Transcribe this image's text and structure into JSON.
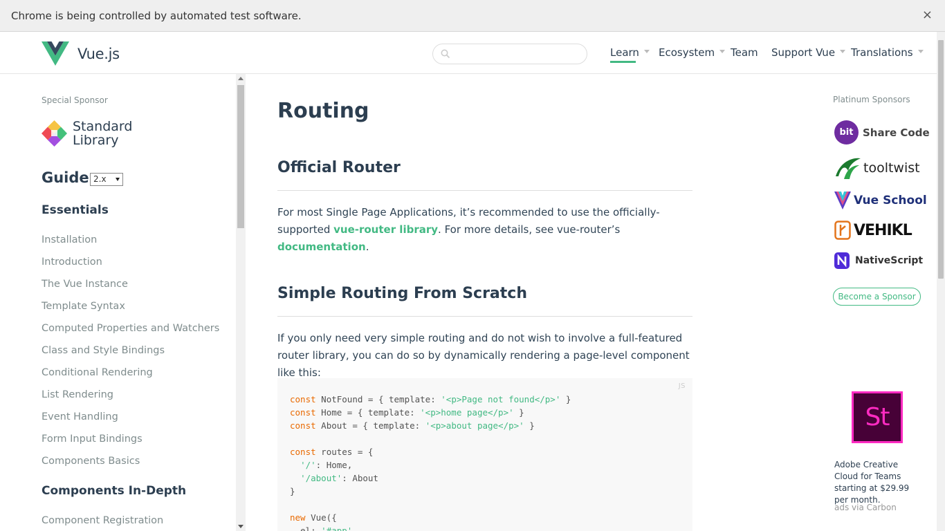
{
  "infobar": {
    "text": "Chrome is being controlled by automated test software.",
    "close": "×"
  },
  "header": {
    "logo_text": "Vue.js",
    "search_placeholder": "",
    "nav": [
      {
        "label": "Learn",
        "dropdown": true,
        "active": true
      },
      {
        "label": "Ecosystem",
        "dropdown": true
      },
      {
        "label": "Team",
        "dropdown": false
      },
      {
        "label": "Support Vue",
        "dropdown": true
      },
      {
        "label": "Translations",
        "dropdown": true
      }
    ]
  },
  "sidebar": {
    "special_sponsor_label": "Special Sponsor",
    "sponsor_line1": "Standard",
    "sponsor_line2": "Library",
    "guide_title": "Guide",
    "version": "2.x",
    "section_essentials": "Essentials",
    "essentials": [
      "Installation",
      "Introduction",
      "The Vue Instance",
      "Template Syntax",
      "Computed Properties and Watchers",
      "Class and Style Bindings",
      "Conditional Rendering",
      "List Rendering",
      "Event Handling",
      "Form Input Bindings",
      "Components Basics"
    ],
    "section_components": "Components In-Depth",
    "components": [
      "Component Registration"
    ]
  },
  "main": {
    "title": "Routing",
    "h2_official": "Official Router",
    "p1_a": "For most Single Page Applications, it’s recommended to use the officially-supported ",
    "p1_link1": "vue-router library",
    "p1_b": ". For more details, see vue-router’s ",
    "p1_link2": "documentation",
    "p1_c": ".",
    "h2_simple": "Simple Routing From Scratch",
    "p2": "If you only need very simple routing and do not wish to involve a full-featured router library, you can do so by dynamically rendering a page-level component like this:",
    "code_lang": "JS"
  },
  "right": {
    "platinum_label": "Platinum Sponsors",
    "sponsors": [
      "Share Code",
      "tooltwist",
      "Vue School",
      "VEHIKL",
      "NativeScript"
    ],
    "bit_label": "bit",
    "become_sponsor": "Become a Sponsor",
    "ad_logo_text": "St",
    "ad_text": "Adobe Creative Cloud for Teams starting at $29.99 per month.",
    "ads_via": "ads via Carbon"
  },
  "colors": {
    "accent": "#42b983",
    "text": "#2c3e50",
    "muted": "#7f8c8d",
    "keyword": "#e96900"
  }
}
